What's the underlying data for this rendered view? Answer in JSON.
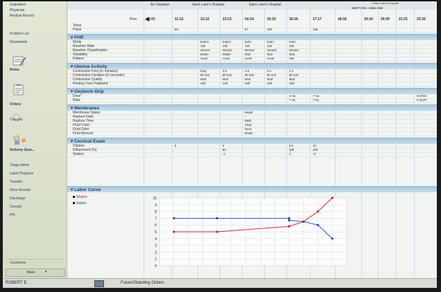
{
  "top_bar": {
    "items": [
      "Arr Departer",
      "Saint Luke's Hospital",
      "Saint Luke's Hospital"
    ],
    "right_text": [
      "Heart Luke's Hospital",
      "SHIFT 0700 - 00/00 0030"
    ]
  },
  "leftnav": {
    "top_links": [
      "Outpatient",
      "Physician",
      "Medical Record"
    ],
    "mid_links": [
      "Problem List",
      "Flowsheets"
    ],
    "icon_items": [
      {
        "label": "Notes",
        "icon": "notes-icon"
      },
      {
        "label": "Orders",
        "icon": "orders-icon"
      },
      {
        "label": "Charges",
        "icon": "charges-icon"
      },
      {
        "label": "Delivery Sum...",
        "icon": "delivery-summary-icon"
      }
    ],
    "bottom_links": [
      "Triage Admit",
      "Labor Progress",
      "Transfer",
      "Floor Rounds",
      "Discharge",
      "Consult",
      "PFI"
    ],
    "customize": "Customize",
    "more": "More"
  },
  "timeline": {
    "prev_label": "Prev",
    "times": [
      "10:01",
      "11:12",
      "12:12",
      "13:13",
      "14:14",
      "15:15",
      "16:16",
      "17:17",
      "18:18",
      "19:19",
      "20:20",
      "21:21",
      "22:22"
    ],
    "top_rows": [
      {
        "label": "Temp",
        "cells": [
          "",
          "",
          "",
          "",
          "",
          "",
          "",
          "",
          "",
          "",
          "",
          "",
          ""
        ]
      },
      {
        "label": "Pulse",
        "cells": [
          "",
          "89",
          "",
          "",
          "97",
          "100",
          "",
          "105",
          "",
          "",
          "",
          "",
          ""
        ]
      }
    ]
  },
  "sections": [
    {
      "title": "FHR",
      "rows": [
        {
          "label": "Mode",
          "cells": [
            "",
            "",
            "Extern",
            "Extern",
            "Extrn",
            "Extrn",
            "Extrn",
            "",
            "",
            "",
            "",
            "",
            ""
          ]
        },
        {
          "label": "Baseline Rate",
          "cells": [
            "",
            "",
            "130",
            "130",
            "130",
            "135",
            "135",
            "",
            "",
            "",
            "",
            "",
            ""
          ]
        },
        {
          "label": "Baseline Classification",
          "cells": [
            "",
            "",
            "Normal",
            "Normal",
            "Normal",
            "Normal",
            "Normal",
            "",
            "",
            "",
            "",
            "",
            ""
          ]
        },
        {
          "label": "Variability",
          "cells": [
            "",
            "",
            "Moder",
            "Moder",
            "Mod",
            "Mod",
            "Mod",
            "",
            "",
            "",
            "",
            "",
            ""
          ]
        },
        {
          "label": "Pattern",
          "cells": [
            "",
            "",
            "Accel",
            "Accel",
            "Accel",
            "Accel",
            "Vari",
            "",
            "",
            "",
            "",
            "",
            ""
          ]
        }
      ]
    },
    {
      "title": "Uterine Activity",
      "rows": [
        {
          "label": "Contraction Freq (in minutes)",
          "cells": [
            "",
            "",
            "Irreg",
            "3-5",
            "4-5",
            "3-4",
            "3-4",
            "",
            "",
            "",
            "",
            "",
            ""
          ]
        },
        {
          "label": "Contraction Duration (in seconds)",
          "cells": [
            "",
            "",
            "90-120",
            "90-120",
            "90-120",
            "90-120",
            "60-120",
            "",
            "",
            "",
            "",
            "",
            ""
          ]
        },
        {
          "label": "Contraction Quality",
          "cells": [
            "",
            "",
            "Mod",
            "Mod",
            "Mod",
            "Mod",
            "Mod",
            "",
            "",
            "",
            "",
            "",
            ""
          ]
        },
        {
          "label": "Resting Tone Palpated",
          "cells": [
            "",
            "",
            "Soft",
            "Soft",
            "Soft",
            "Soft",
            "Soft",
            "",
            "",
            "",
            "",
            "",
            ""
          ]
        }
      ]
    },
    {
      "title": "Oxytocin Drip",
      "rows": [
        {
          "label": "Dose",
          "cells": [
            "",
            "",
            "",
            "",
            "",
            "",
            "2 mu",
            "7 mu",
            "",
            "",
            "",
            "",
            "mU/min"
          ]
        },
        {
          "label": "Rate",
          "cells": [
            "",
            "",
            "",
            "",
            "",
            "",
            "7 mL",
            "7 mL",
            "",
            "",
            "",
            "",
            "0 mL/hr"
          ]
        }
      ]
    },
    {
      "title": "Membranes",
      "rows": [
        {
          "label": "Membrane Status",
          "cells": [
            "",
            "",
            "",
            "",
            "Ruptd",
            "",
            "",
            "",
            "",
            "",
            "",
            "",
            ""
          ]
        },
        {
          "label": "Rupture Date",
          "cells": [
            "",
            "",
            "",
            "",
            "--",
            "",
            "",
            "",
            "",
            "",
            "",
            "",
            ""
          ]
        },
        {
          "label": "Rupture Time",
          "cells": [
            "",
            "",
            "",
            "",
            "0800",
            "",
            "",
            "",
            "",
            "",
            "",
            "",
            ""
          ]
        },
        {
          "label": "Fluid Color",
          "cells": [
            "",
            "",
            "",
            "",
            "Clear",
            "",
            "",
            "",
            "",
            "",
            "",
            "",
            ""
          ]
        },
        {
          "label": "Fluid Odor",
          "cells": [
            "",
            "",
            "",
            "",
            "None",
            "",
            "",
            "",
            "",
            "",
            "",
            "",
            ""
          ]
        },
        {
          "label": "Fluid Amount",
          "cells": [
            "",
            "",
            "",
            "",
            "Moder",
            "",
            "",
            "",
            "",
            "",
            "",
            "",
            ""
          ]
        }
      ]
    },
    {
      "title": "Cervical Exam",
      "rows": [
        {
          "label": "Dilation",
          "cells": [
            "",
            "5",
            "",
            "6",
            "",
            "",
            "6.5",
            "10",
            "",
            "",
            "",
            "",
            ""
          ]
        },
        {
          "label": "Effacement (%)",
          "cells": [
            "",
            "",
            "",
            "90",
            "",
            "",
            "100",
            "100",
            "",
            "",
            "",
            "",
            ""
          ]
        },
        {
          "label": "Station",
          "cells": [
            "",
            "",
            "",
            "-2",
            "",
            "",
            "1",
            "+1",
            "",
            "",
            "",
            "",
            ""
          ]
        }
      ]
    }
  ],
  "labor_curve": {
    "title": "Labor Curve",
    "legend": [
      {
        "name": "Dilation",
        "color": "#d02020"
      },
      {
        "name": "Station",
        "color": "#2040c0"
      }
    ],
    "y_ticks": [
      "10",
      "9",
      "8",
      "7",
      "6",
      "5",
      "4",
      "3",
      "2",
      "1",
      "0"
    ]
  },
  "chart_data": {
    "type": "line",
    "title": "Labor Curve",
    "ylim": [
      0,
      10
    ],
    "series": [
      {
        "name": "Dilation",
        "color": "#d02020",
        "points": [
          [
            1,
            5
          ],
          [
            4,
            5
          ],
          [
            9,
            5.8
          ],
          [
            10,
            6.5
          ],
          [
            11,
            8
          ],
          [
            12,
            10
          ]
        ]
      },
      {
        "name": "Station",
        "color": "#2040c0",
        "points": [
          [
            1,
            7
          ],
          [
            4,
            7
          ],
          [
            9,
            7
          ],
          [
            9,
            6.7
          ],
          [
            10,
            6.5
          ],
          [
            11,
            6
          ],
          [
            12,
            4
          ]
        ]
      }
    ]
  },
  "bottom": {
    "user": "ROBERT E.",
    "tab": "Future/Standing Orders"
  }
}
